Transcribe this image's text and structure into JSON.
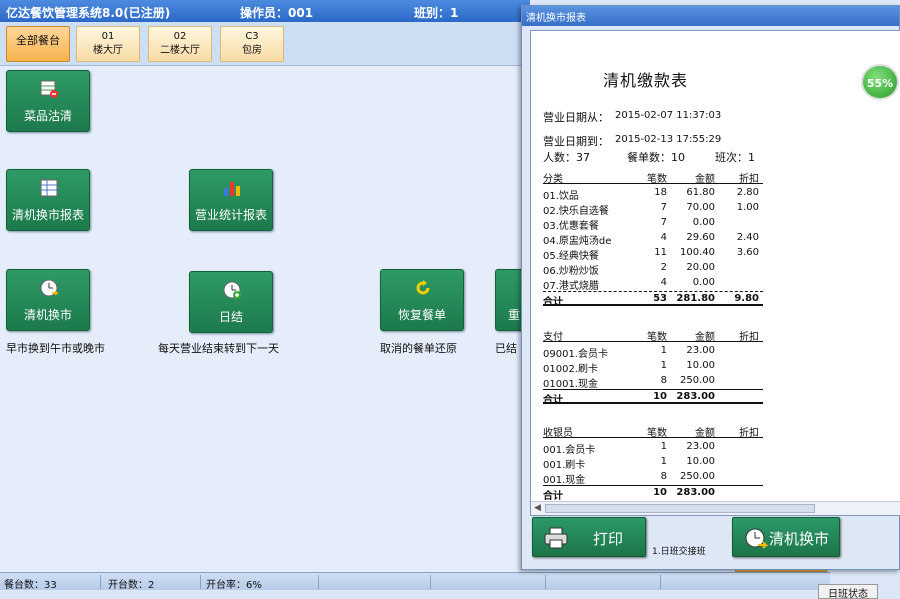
{
  "titlebar": {
    "app_title": "亿达餐饮管理系统8.0(已注册)",
    "operator": "操作员：001",
    "shift": "班别：1"
  },
  "tabs": [
    {
      "code": "",
      "name": "全部餐台"
    },
    {
      "code": "01",
      "name": "楼大厅"
    },
    {
      "code": "02",
      "name": "二楼大厅"
    },
    {
      "code": "C3",
      "name": "包房"
    }
  ],
  "tiles": {
    "clear_dishes": "菜品沽清",
    "shift_report": "清机换市报表",
    "business_report": "营业统计报表",
    "shift_change": "清机换市",
    "daily_close": "日结",
    "restore_order": "恢复餐单",
    "partial": "重"
  },
  "captions": {
    "shift_change": "早市换到午市或晚市",
    "daily_close": "每天营业结束转到下一天",
    "restore_order": "取消的餐单还原",
    "partial": "已结"
  },
  "statusbar": {
    "tables": "餐台数：33",
    "open": "开台数：2",
    "rate": "开台率：6%"
  },
  "report_window": {
    "title": "清机换市报表",
    "badge": "55%",
    "print_button": "打印",
    "shift_button": "清机换市",
    "hint": "1.日班交接班"
  },
  "report": {
    "title": "清机缴款表",
    "start_label": "营业日期从：",
    "start_value": "2015-02-07 11:37:03",
    "end_label": "营业日期到：",
    "end_value": "2015-02-13 17:55:29",
    "people": "人数：37",
    "orders": "餐单数：10",
    "shift": "班次：1",
    "category_table": {
      "headers": [
        "分类",
        "笔数",
        "金额",
        "折扣"
      ],
      "rows": [
        [
          "01.饮品",
          "18",
          "61.80",
          "2.80"
        ],
        [
          "02.快乐自选餐",
          "7",
          "70.00",
          "1.00"
        ],
        [
          "03.优惠套餐",
          "7",
          "0.00",
          ""
        ],
        [
          "04.原盅炖汤de",
          "4",
          "29.60",
          "2.40"
        ],
        [
          "05.经典快餐",
          "11",
          "100.40",
          "3.60"
        ],
        [
          "06.炒粉炒饭",
          "2",
          "20.00",
          ""
        ],
        [
          "07.港式烧腊",
          "4",
          "0.00",
          ""
        ]
      ],
      "total": [
        "合计",
        "53",
        "281.80",
        "9.80"
      ]
    },
    "payment_table": {
      "headers": [
        "支付",
        "笔数",
        "金额",
        "折扣"
      ],
      "rows": [
        [
          "09001.会员卡",
          "1",
          "23.00",
          ""
        ],
        [
          "01002.刷卡",
          "1",
          "10.00",
          ""
        ],
        [
          "01001.现金",
          "8",
          "250.00",
          ""
        ]
      ],
      "total": [
        "合计",
        "10",
        "283.00",
        ""
      ]
    },
    "cashier_table": {
      "headers": [
        "收银员",
        "笔数",
        "金额",
        "折扣"
      ],
      "rows": [
        [
          "001.会员卡",
          "1",
          "23.00",
          ""
        ],
        [
          "001.刷卡",
          "1",
          "10.00",
          ""
        ],
        [
          "001.现金",
          "8",
          "250.00",
          ""
        ]
      ],
      "total": [
        "合计",
        "10",
        "283.00",
        ""
      ]
    }
  },
  "bottom_right": "日班状态"
}
